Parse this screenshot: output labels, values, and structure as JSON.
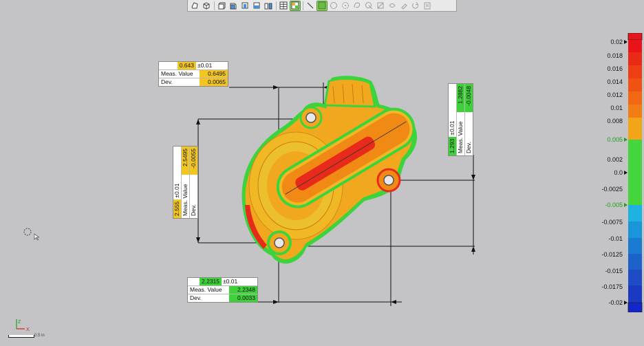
{
  "annotations": {
    "top": {
      "nominal": "0.643",
      "tolerance": "±0.01",
      "meas_label": "Meas. Value",
      "meas_value": "0.6495",
      "dev_label": "Dev.",
      "dev_value": "0.0065"
    },
    "left": {
      "nominal": "2.555",
      "tolerance": "±0.01",
      "meas_label": "Meas. Value",
      "meas_value": "2.5495",
      "dev_label": "Dev.",
      "dev_value": "-0.0055"
    },
    "right": {
      "nominal": "1.293",
      "tolerance": "±0.01",
      "meas_label": "Meas. Value",
      "meas_value": "1.2882",
      "dev_label": "Dev.",
      "dev_value": "-0.0048"
    },
    "bottom": {
      "nominal": "2.2315",
      "tolerance": "±0.01",
      "meas_label": "Meas. Value",
      "meas_value": "2.2348",
      "dev_label": "Dev.",
      "dev_value": "0.0033"
    }
  },
  "colorbar": {
    "labels": [
      "0.02",
      "0.018",
      "0.016",
      "0.014",
      "0.012",
      "0.01",
      "0.008",
      "0.005",
      "0.002",
      "0.0",
      "-0.0025",
      "-0.005",
      "-0.0075",
      "-0.01",
      "-0.0125",
      "-0.015",
      "-0.0175",
      "-0.02"
    ],
    "highlight_labels": [
      "0.005",
      "-0.005"
    ],
    "colors": {
      "red": "#e8141a",
      "orange": "#f06a13",
      "yellow": "#f1c21a",
      "green": "#3dd33c",
      "cyan": "#22a9df",
      "blue": "#1f5cc4",
      "navy": "#1528c8"
    }
  },
  "axis_indicator": {
    "x": "X",
    "z": "Z"
  },
  "scale": {
    "label": "0.5 in"
  },
  "toolbar": {
    "icons": [
      "shape-icon",
      "cube-icon",
      "cube-front-icon",
      "cube-side-icon",
      "view-front-icon",
      "view-top-icon",
      "view-right-icon",
      "grid-icon",
      "grid-selected-icon",
      "line-icon",
      "mesh-select-icon",
      "circle-icon",
      "pivot-icon",
      "lasso-icon",
      "select-lasso-icon",
      "clip-icon",
      "move-icon",
      "paint-icon",
      "reset-icon",
      "export-icon"
    ]
  }
}
